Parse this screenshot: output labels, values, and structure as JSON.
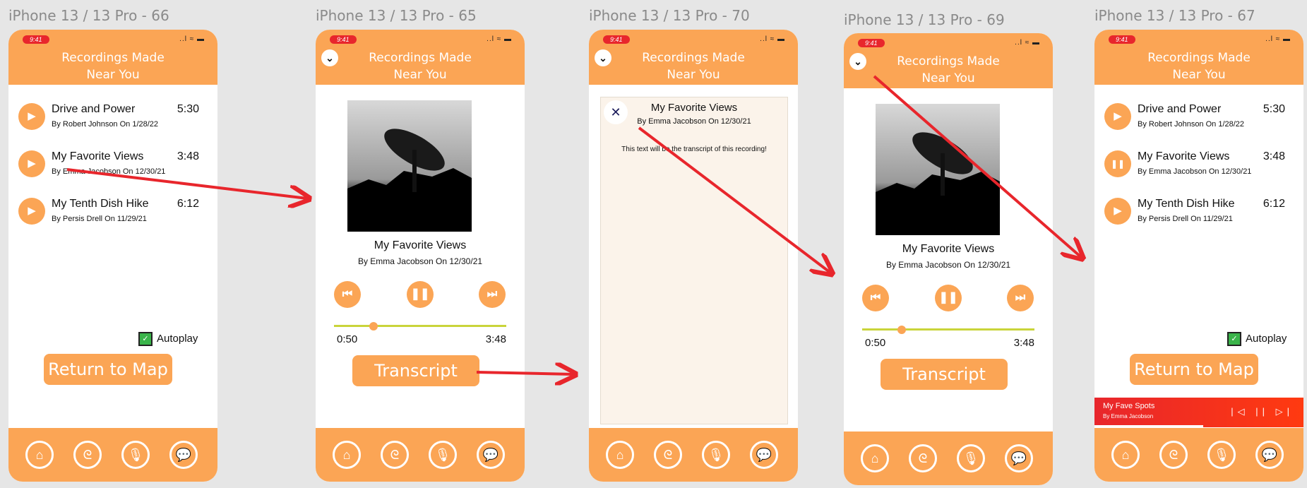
{
  "frames": [
    {
      "title": "iPhone 13 / 13 Pro - 66"
    },
    {
      "title": "iPhone 13 / 13 Pro - 65"
    },
    {
      "title": "iPhone 13 / 13 Pro - 70"
    },
    {
      "title": "iPhone 13 / 13 Pro - 69"
    },
    {
      "title": "iPhone 13 / 13 Pro - 67"
    }
  ],
  "status": {
    "time": "9:41",
    "signal": "..l ≈ ▬"
  },
  "header": {
    "line1": "Recordings Made",
    "line2": "Near You"
  },
  "recordings": [
    {
      "title": "Drive and Power",
      "by": "By Robert Johnson On 1/28/22",
      "duration": "5:30"
    },
    {
      "title": "My Favorite Views",
      "by": "By Emma Jacobson On 12/30/21",
      "duration": "3:48"
    },
    {
      "title": "My Tenth Dish Hike",
      "by": "By Persis Drell On 11/29/21",
      "duration": "6:12"
    }
  ],
  "autoplay_label": "Autoplay",
  "return_label": "Return to Map",
  "now_playing": {
    "title": "My Favorite Views",
    "by": "By Emma Jacobson On 12/30/21",
    "current": "0:50",
    "total": "3:48",
    "progress": 0.23
  },
  "transcript_label": "Transcript",
  "transcript_text": "This text will be the transcript of this recording!",
  "mini_player": {
    "title": "My Fave Spots",
    "by": "By Emma Jacobson",
    "progress": 0.52
  },
  "icons": {
    "play": "▶",
    "pause": "❚❚",
    "prev": "⏮",
    "next": "⏭",
    "close": "✕",
    "chevron": "⌄",
    "home": "⌂",
    "ear": "ᘓ",
    "mic": "🎙",
    "chat": "💬",
    "check": "✓"
  },
  "colors": {
    "accent": "#fba555",
    "header": "#fba555",
    "arrow": "#e8262c",
    "status_time": "#e8262c",
    "track": "#c9d43a"
  }
}
